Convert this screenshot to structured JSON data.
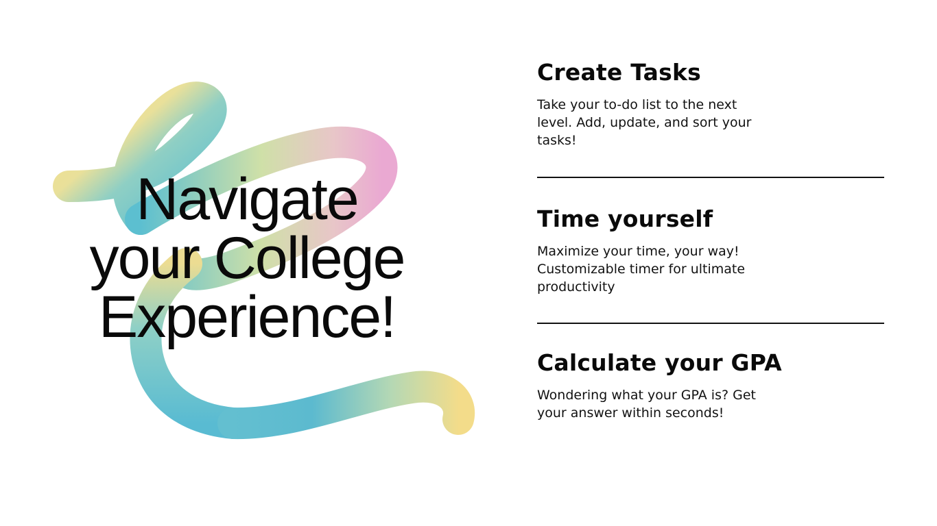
{
  "hero": {
    "line1": "Navigate",
    "line2": "your College",
    "line3": "Experience!"
  },
  "features": [
    {
      "title": "Create Tasks",
      "description": "Take your to-do list to the next level. Add, update, and sort your tasks!"
    },
    {
      "title": "Time yourself",
      "description": "Maximize your time, your way! Customizable timer for ultimate productivity"
    },
    {
      "title": "Calculate your GPA",
      "description": "Wondering what your GPA is? Get your answer within seconds!"
    }
  ],
  "colors": {
    "swirl_yellow": "#f3dc8a",
    "swirl_teal": "#5ebfd0",
    "swirl_pink": "#eab0d0",
    "text": "#0a0a0a"
  },
  "decor": {
    "swirl": "gradient-swirl-ribbon"
  }
}
